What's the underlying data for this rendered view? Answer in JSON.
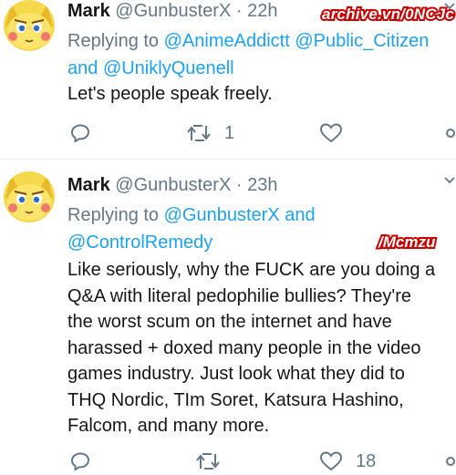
{
  "watermark": "archive.vn/0NCJc",
  "tag": "/Mcmzu",
  "colors": {
    "link": "#1da1f2",
    "secondary": "#657786",
    "primary": "#14171a",
    "watermark_stroke": "#c80000"
  },
  "tweets": [
    {
      "name": "Mark",
      "handle": "@GunbusterX",
      "sep": "·",
      "time": "22h",
      "replying_label": "Replying to",
      "mentions": [
        "@AnimeAddictt",
        "@Public_Citizen",
        "@UniklyQuenell"
      ],
      "and_label": "and",
      "text": "Let's people speak freely.",
      "reply_count": "",
      "retweet_count": "1",
      "like_count": ""
    },
    {
      "name": "Mark",
      "handle": "@GunbusterX",
      "sep": "·",
      "time": "23h",
      "replying_label": "Replying to",
      "mentions": [
        "@GunbusterX",
        "@ControlRemedy"
      ],
      "and_label": "and",
      "text_lines": [
        "Like seriously, why the FUCK are you doing a",
        "Q&A with literal pedophilie bullies? They're",
        "the worst scum on the internet and have",
        "harassed + doxed many people in the video",
        "games industry. Just look what they did to",
        "THQ Nordic, TIm Soret, Katsura Hashino,",
        "Falcom, and many more."
      ],
      "reply_count": "",
      "retweet_count": "",
      "like_count": "18"
    }
  ],
  "icons": {
    "reply": "reply-icon",
    "retweet": "retweet-icon",
    "like": "heart-icon",
    "share": "share-icon",
    "more": "chevron-down-icon"
  }
}
